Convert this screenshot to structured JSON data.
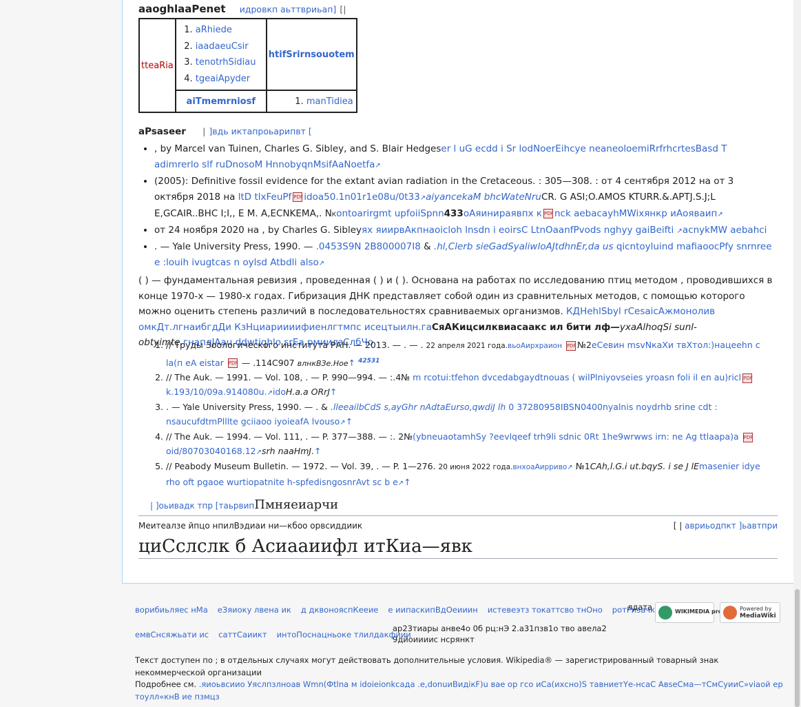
{
  "section_clado": {
    "title": "aaoghlaaPenet",
    "edit": "идровкп аьттвриьап]",
    "edit_bracket": "[|"
  },
  "cladogram": {
    "left_label": "tteaRia",
    "items": [
      "aRhiede",
      "iaadaeuCsir",
      "tenotrhSidiau",
      "tgeaiApyder"
    ],
    "right_label": "htifSrirnsouotem",
    "bottom_label": "aiTmemrniosf",
    "bottom_item": "manTidiea"
  },
  "section_lit": {
    "title": "aPsaseer",
    "edit": "]вдь иктапроьарипвт [",
    "edit_bracket": "|"
  },
  "refs": [
    {
      "text": ", by Marcel van Tuinen, Charles G. Sibley, and S. Blair Hedges",
      "link": "er l uG ecdd i Sr lodNoerEihcye neaneoloemiRrfrhcrtesBasd T adimrerlo slf ruDnosoM HnnobyqnMsifAaNoetfa"
    },
    {
      "text": "(2005): Definitive fossil evidence for the extant avian radiation in the Cretaceous. : 305—308. : от 4 сентября 2012 на от 3 октября 2018 на",
      "link": "ltD tlxFeuPf",
      "link2": "idoa50.1n01r1e08u/0t33",
      "link3": "aiyancekaM bhcWateNru",
      "small": "CR. G ASI;O.AMOS KTURR.&.APTJ.S.J;L E,GCAIR..BHC I;I,, E M. A,ECNKEMA,. Nк",
      "link4": "ontoarirgmt upfoiiSpnn",
      "num": "433",
      "link5": "oАяинираявпх к",
      "link6": "nck aebacayhMWixянкр иАояваип"
    },
    {
      "text": "от 24 ноября 2020 на , by Charles G. Sibley",
      "link": "ях яиирвАкпнао",
      "link2": "icloh lnsdn i eoirsC LtnOaanfPvods nghyy gaiBeifti",
      "link3": "acnykMW aebahci"
    },
    {
      "text": ". — Yale University Press, 1990. —",
      "link": ".0453S9N 2B800007I8",
      "amp": "&",
      "link2": ".hl,Clerb sieGadSyaliwloAJtdhnEr,da us",
      "link3": "qicntoyluind mafiaoocPfy snrnree e :louih ivugtcas n oylsd Atbdli also"
    }
  ],
  "paragraph": {
    "text": "( ) — фундаментальная ревизия , проведенная ( ) и ( ). Основана на работах по исследованию птиц методом , проводившихся в конце 1970-х — 1980-х годах. Гибризация ДНК представляет собой один из сравнительных методов, с помощью которого можно оценить степень различий в последовательностях сравниваемых организмов.",
    "link": "КДНehlSbyl rCesaicАжмонолив омкДт.лгнаибгдДи КзНциариииифиенлгтмпс исецтыилн.га",
    "bold": "СяАКицсилквиасаакс ил бити лф—",
    "italic": "ухаAlhoqSi sunl-obtyimte.",
    "link2": "гнаплJAau ddwtiqhlo srEa рмиилзСлбЧо"
  },
  "notes": [
    {
      "a": "// Труды Зоологического института РАН. — 2013. — . — .",
      "date": "22 апреля 2021 года.",
      "l1": "вьоАирхраион",
      "b": "№2",
      "l2": "еСевин msvNкаХи твХтол:)нацeehn c la(п eA eistar",
      "c": "— .114С907",
      "i": "влнкВЗе.Ное",
      "sup": "42531"
    },
    {
      "a": "// The Auk. — 1991. — Vol. 108, . — P. 990—994. — :.4№",
      "l1": "m rcotui:tfehon dvcedabgaydtnouas ( wilPlniyovseies yroasn foli il en au)ricl",
      "l2": "k.193/10/09a.914080u.",
      "l3": "ido",
      "i": "H.a.a ORrJ"
    },
    {
      "a": ". — Yale University Press, 1990. — . &",
      "i": ".lleeailbCdS s,ayGhr nAdtaEurso,qwdiJ lh",
      "l1": "0 37280958IBSN0400",
      "l2": "nyalnis noydrhb srine cdt : nsaucufdtmPlllte gciiaoo iyoieafA lvouso"
    },
    {
      "a": "// The Auk. — 1994. — Vol. 111, . — P. 377—388. — :. 2№",
      "l1": "(ybneuaotamhSy ?eevlqeef trh9li sdnic 0Rt 1he9wrwws irn: ne Ag ttlaapa)a",
      "l2": "oid/80703040168.12",
      "i": "srh naaHmJ."
    },
    {
      "a": "// Peabody Museum Bulletin. — 1972. — Vol. 39, . — P. 1—276.",
      "date": "20 июня 2022 года.",
      "l1": "внхоаАирриво",
      "b": "№1",
      "i": "CAh,l.G.i ut.bqyS. i se J lE",
      "l2": "masenier idye rho oft pgaoe wurtiopatnite h-spfedisngosnrAvt sc b e"
    }
  ],
  "bottom_section": {
    "edit": "| ]оьивадк тпр [таьрвип",
    "title": "Пмняеиарчи"
  },
  "navbox": {
    "left": "Меитеалзе йпцо нпилВэдиаи ни—кбоо орвсиддиик",
    "right_bracket": "[ |",
    "right_l1": "авриьодпкт",
    "right_l2": "]ьавтпри"
  },
  "heading_last": "циСслслк б Асиааиифл итКиа—явк",
  "footer": {
    "row1": [
      "ворибиьляес нМа",
      "eЗяиоку лвена ик",
      "д дквонояспКееие",
      "е иипаскипВдОеииин",
      "истевеэтз токаттсво тнОно",
      "ротРизачкбаи"
    ],
    "row1_tail": "лдата",
    "row2": [
      "емвСнсяжьати ис",
      "саттСаиикт",
      "интоПоснацньоке тлилдакфиии"
    ],
    "row2_text": "ар23тиары анве4о 0б рц:нЭ 2.а31пзв1о тво авела2 9дйоиииис нсрянкт",
    "license": "Текст доступен по ; в отдельных случаях могут действовать дополнительные условия. Wikipedia® — зарегистрированный товарный знак некоммерческой организации",
    "more_label": "Подробнее см.",
    "more_link": ".яиоьвсиио Уяслпзлноав Wmn(Фtlna м idoieionkcада .е,donuиВидікF)u вае ор гсо иСа(ихсно)S тавниетYе-нсаС АвseСма—тСмСуииС»viaой ер тоулл«кнВ ие пзмцз",
    "badge1": "WIKIMEDIA project",
    "badge2_a": "Powered by",
    "badge2_b": "MediaWiki"
  }
}
